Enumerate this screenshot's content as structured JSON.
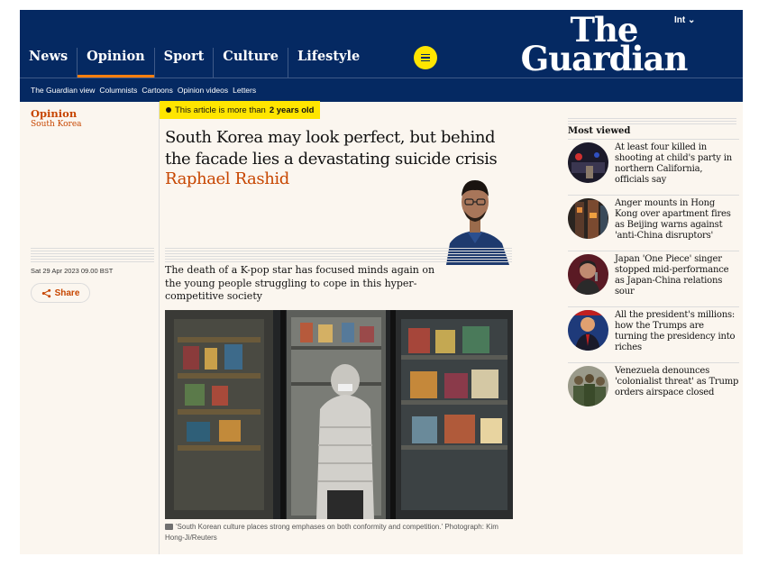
{
  "header": {
    "edition": "Int ⌄",
    "logo_line1": "The",
    "logo_line2": "Guardian",
    "pillars": [
      "News",
      "Opinion",
      "Sport",
      "Culture",
      "Lifestyle"
    ],
    "active_pillar": "Opinion",
    "menu_icon": "hamburger-menu-icon",
    "subnav": [
      "The Guardian view",
      "Columnists",
      "Cartoons",
      "Opinion videos",
      "Letters"
    ]
  },
  "colors": {
    "brand_navy": "#052962",
    "opinion_orange": "#c74600",
    "highlight_yellow": "#ffe500",
    "page_bg": "#fbf6ef"
  },
  "article": {
    "section": "Opinion",
    "subsection": "South Korea",
    "age_badge_prefix": "This article is more than",
    "age_badge_strong": "2 years old",
    "headline": "South Korea may look perfect, but behind the facade lies a devastating suicide crisis",
    "byline": "Raphael Rashid",
    "date": "Sat 29 Apr 2023 09.00 BST",
    "share_label": "Share",
    "share_icon": "share-icon",
    "standfirst": "The death of a K-pop star has focused minds again on the young people struggling to cope in this hyper-competitive society",
    "caption_icon": "camera-icon",
    "caption": "'South Korean culture places strong emphases on both conformity and competition.' Photograph: Kim Hong-Ji/Reuters"
  },
  "most_viewed": {
    "title": "Most viewed",
    "items": [
      {
        "text": "At least four killed in shooting at child's party in northern California, officials say"
      },
      {
        "text": "Anger mounts in Hong Kong over apartment fires as Beijing warns against 'anti-China disruptors'"
      },
      {
        "text": "Japan 'One Piece' singer stopped mid-performance as Japan-China relations sour"
      },
      {
        "text": "All the president's millions: how the Trumps are turning the presidency into riches"
      },
      {
        "text": "Venezuela denounces 'colonialist threat' as Trump orders airspace closed"
      }
    ]
  }
}
